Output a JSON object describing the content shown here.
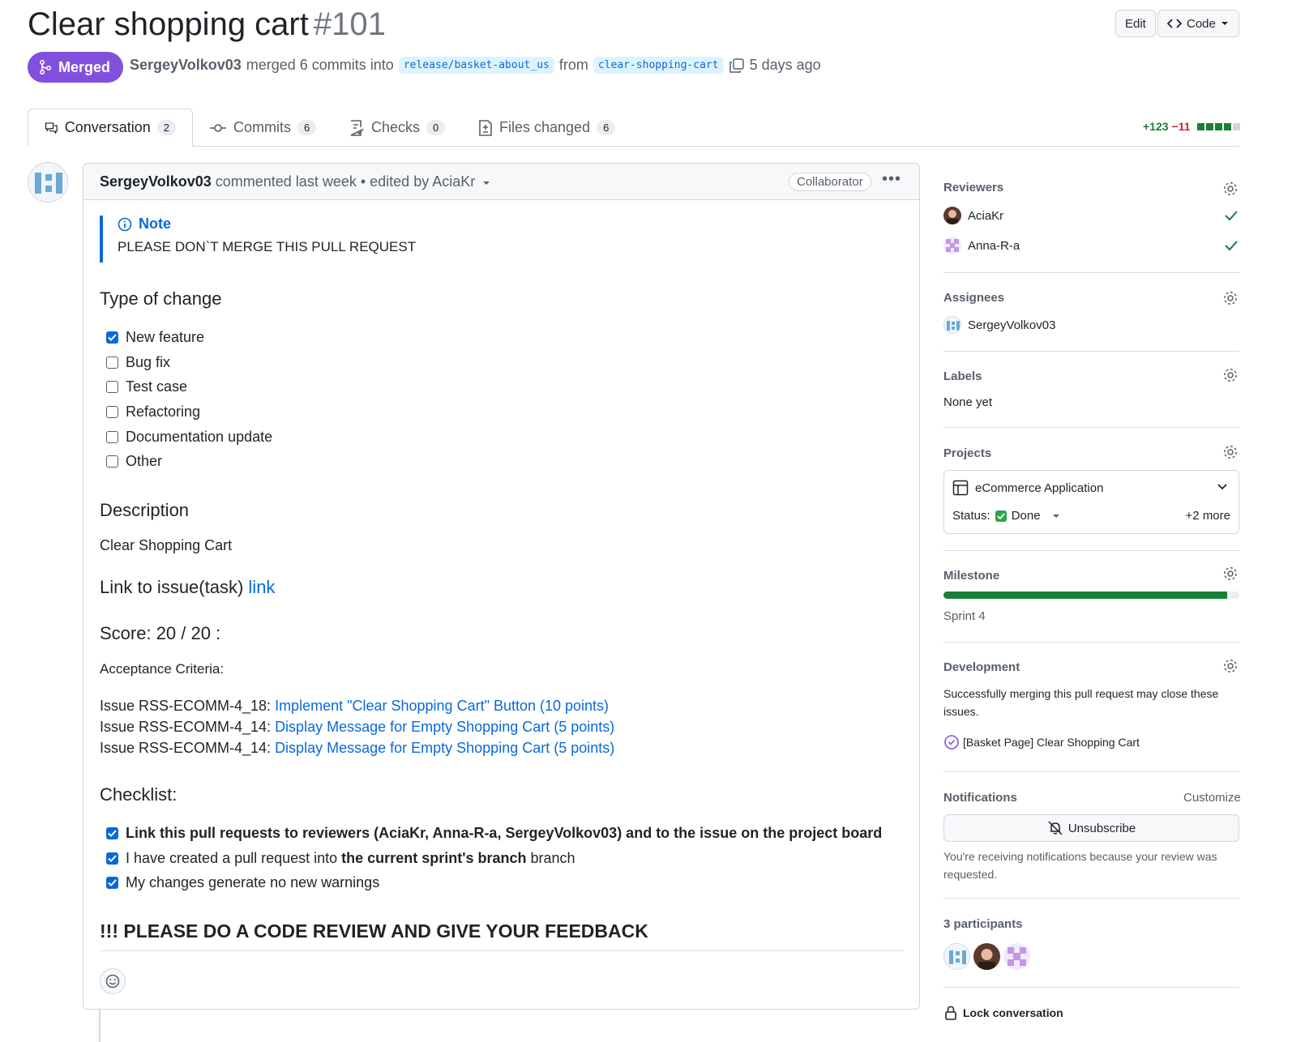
{
  "header": {
    "title": "Clear shopping cart",
    "number": "#101",
    "edit_label": "Edit",
    "code_label": "Code",
    "state": "Merged",
    "author": "SergeyVolkov03",
    "merged_text": "merged 6 commits into",
    "base_branch": "release/basket-about_us",
    "from_text": "from",
    "head_branch": "clear-shopping-cart",
    "time": "5 days ago"
  },
  "tabs": [
    {
      "label": "Conversation",
      "count": "2",
      "icon": "comment-discussion-icon"
    },
    {
      "label": "Commits",
      "count": "6",
      "icon": "git-commit-icon"
    },
    {
      "label": "Checks",
      "count": "0",
      "icon": "checklist-icon"
    },
    {
      "label": "Files changed",
      "count": "6",
      "icon": "file-diff-icon"
    }
  ],
  "diffstat": {
    "additions": "+123",
    "deletions": "−11",
    "blocks": [
      "green",
      "green",
      "green",
      "green",
      "gray"
    ]
  },
  "comment": {
    "author": "SergeyVolkov03",
    "meta": "commented last week • edited by AciaKr",
    "role": "Collaborator",
    "note_title": "Note",
    "note_body": "PLEASE DON`T MERGE THIS PULL REQUEST",
    "type_heading": "Type of change",
    "types": [
      {
        "label": "New feature",
        "checked": true
      },
      {
        "label": "Bug fix",
        "checked": false
      },
      {
        "label": "Test case",
        "checked": false
      },
      {
        "label": "Refactoring",
        "checked": false
      },
      {
        "label": "Documentation update",
        "checked": false
      },
      {
        "label": "Other",
        "checked": false
      }
    ],
    "description_heading": "Description",
    "description": "Clear Shopping Cart",
    "link_heading": "Link to issue(task)",
    "link_text": "link",
    "score_heading": "Score: 20 / 20 :",
    "criteria_heading": "Acceptance Criteria:",
    "criteria": [
      {
        "prefix": "Issue RSS-ECOMM-4_18: ",
        "link": "Implement \"Clear Shopping Cart\" Button (10 points)"
      },
      {
        "prefix": "Issue RSS-ECOMM-4_14: ",
        "link": "Display Message for Empty Shopping Cart (5 points)"
      },
      {
        "prefix": "Issue RSS-ECOMM-4_14: ",
        "link": "Display Message for Empty Shopping Cart (5 points)"
      }
    ],
    "checklist_heading": "Checklist:",
    "checklist": {
      "item1": "Link this pull requests to reviewers (AciaKr, Anna-R-a, SergeyVolkov03) and to the issue on the project board",
      "item2_pre": "I have created a pull request into ",
      "item2_bold": "the current sprint's branch",
      "item2_post": " branch",
      "item3": "My changes generate no new warnings"
    },
    "final_heading": "!!! PLEASE DO A CODE REVIEW AND GIVE YOUR FEEDBACK"
  },
  "sidebar": {
    "reviewers_heading": "Reviewers",
    "reviewers": [
      "AciaKr",
      "Anna-R-a"
    ],
    "assignees_heading": "Assignees",
    "assignee": "SergeyVolkov03",
    "labels_heading": "Labels",
    "labels_value": "None yet",
    "projects_heading": "Projects",
    "project_name": "eCommerce Application",
    "status_label": "Status:",
    "status_value": "Done",
    "more": "+2 more",
    "milestone_heading": "Milestone",
    "milestone_progress": 0.96,
    "milestone_name": "Sprint 4",
    "development_heading": "Development",
    "development_text": "Successfully merging this pull request may close these issues.",
    "linked_issue": "[Basket Page] Clear Shopping Cart",
    "notifications_heading": "Notifications",
    "customize": "Customize",
    "unsubscribe": "Unsubscribe",
    "notif_reason": "You're receiving notifications because your review was requested.",
    "participants": "3 participants",
    "lock": "Lock conversation"
  },
  "colors": {
    "merged": "#8250df",
    "link": "#0969da",
    "success": "#1a7f37"
  }
}
